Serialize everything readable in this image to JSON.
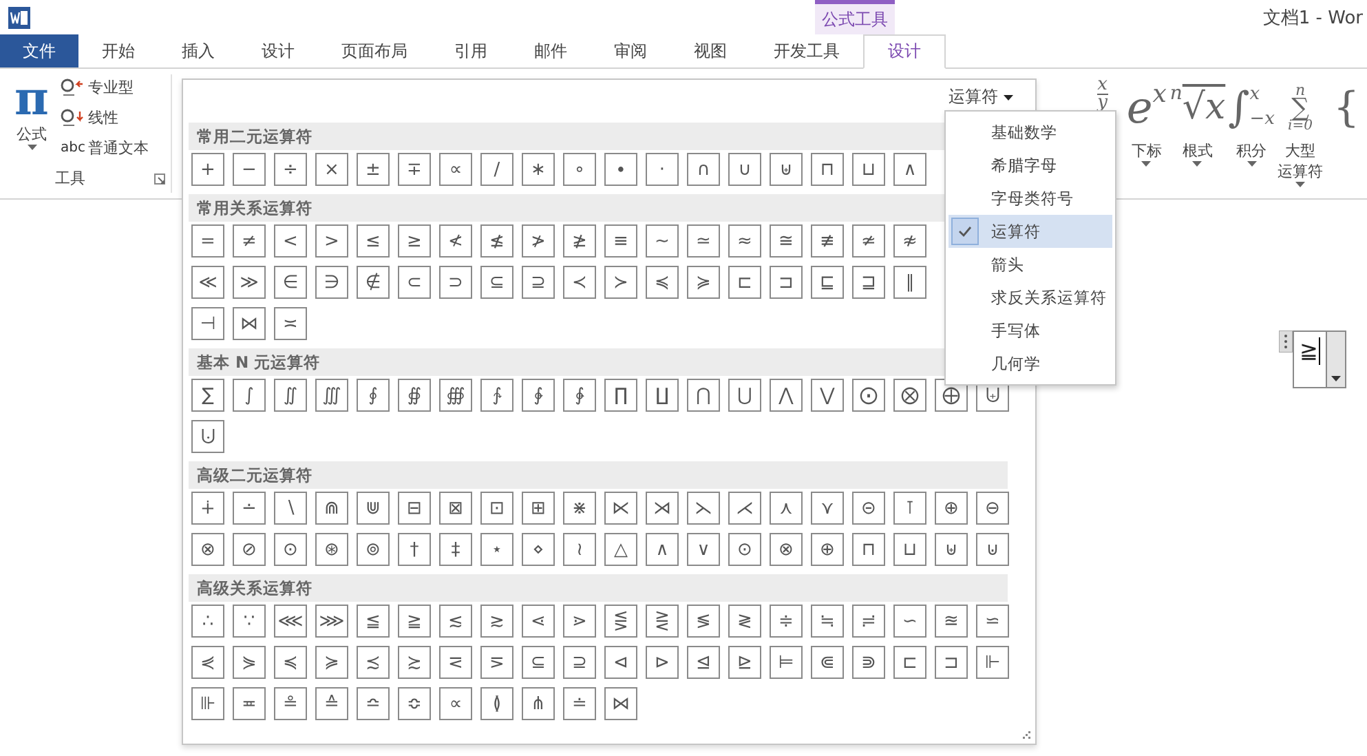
{
  "title_bar": {
    "title": "文档1 - Wor"
  },
  "contextual_group": {
    "label": "公式工具"
  },
  "tabs": [
    {
      "label": "文件",
      "kind": "file",
      "selected": false
    },
    {
      "label": "开始",
      "kind": "normal",
      "selected": false
    },
    {
      "label": "插入",
      "kind": "normal",
      "selected": false
    },
    {
      "label": "设计",
      "kind": "normal",
      "selected": false
    },
    {
      "label": "页面布局",
      "kind": "normal",
      "selected": false
    },
    {
      "label": "引用",
      "kind": "normal",
      "selected": false
    },
    {
      "label": "邮件",
      "kind": "normal",
      "selected": false
    },
    {
      "label": "审阅",
      "kind": "normal",
      "selected": false
    },
    {
      "label": "视图",
      "kind": "normal",
      "selected": false
    },
    {
      "label": "开发工具",
      "kind": "normal",
      "selected": false
    },
    {
      "label": "设计",
      "kind": "contextual",
      "selected": true
    }
  ],
  "tools_group": {
    "label": "工具",
    "equation_button": {
      "icon": "π",
      "label": "公式"
    },
    "options": [
      {
        "label": "专业型",
        "kind": "professional"
      },
      {
        "label": "线性",
        "kind": "linear"
      },
      {
        "label": "普通文本",
        "kind": "text",
        "prefix": "abc"
      }
    ]
  },
  "structures": [
    {
      "kind": "fraction",
      "upper": "x",
      "lower": "y"
    },
    {
      "kind": "script",
      "main": "e",
      "upper": "x",
      "label": "下标"
    },
    {
      "kind": "radical",
      "main": "√x",
      "upper": "n",
      "label": "根式"
    },
    {
      "kind": "integral",
      "main": "∫",
      "upper": "x",
      "lower": "−x",
      "label": "积分"
    },
    {
      "kind": "large-operator",
      "main": "∑",
      "upper": "n",
      "lower": "i=0",
      "label_lines": [
        "大型",
        "运算符"
      ]
    },
    {
      "kind": "bracket",
      "main": "{"
    }
  ],
  "gallery": {
    "category": "运算符",
    "sections": [
      {
        "title": "常用二元运算符",
        "rows": [
          [
            "+",
            "−",
            "÷",
            "×",
            "±",
            "∓",
            "∝",
            "∕",
            "∗",
            "∘",
            "∙",
            "⋅",
            "∩",
            "∪",
            "⊎",
            "⊓",
            "⊔",
            "∧"
          ]
        ]
      },
      {
        "title": "常用关系运算符",
        "rows": [
          [
            "=",
            "≠",
            "<",
            ">",
            "≤",
            "≥",
            "≮",
            "≰",
            "≯",
            "≱",
            "≡",
            "∼",
            "≃",
            "≈",
            "≅",
            "≢",
            "≄",
            "≉"
          ],
          [
            "≪",
            "≫",
            "∈",
            "∋",
            "∉",
            "⊂",
            "⊃",
            "⊆",
            "⊇",
            "≺",
            "≻",
            "≼",
            "≽",
            "⊏",
            "⊐",
            "⊑",
            "⊒",
            "∥"
          ],
          [
            "⊣",
            "⋈",
            "≍"
          ]
        ]
      },
      {
        "title": "基本 N 元运算符",
        "rows": [
          [
            "∑",
            "∫",
            "∬",
            "∭",
            "∮",
            "∯",
            "∰",
            "∱",
            "∲",
            "∳",
            "∏",
            "∐",
            "⋂",
            "⋃",
            "⋀",
            "⋁",
            "⨀",
            "⨂",
            "⨁",
            "⨄"
          ],
          [
            "⨃"
          ]
        ]
      },
      {
        "title": "高级二元运算符",
        "rows": [
          [
            "∔",
            "∸",
            "∖",
            "⋒",
            "⋓",
            "⊟",
            "⊠",
            "⊡",
            "⊞",
            "⋇",
            "⋉",
            "⋊",
            "⋋",
            "⋌",
            "⋏",
            "⋎",
            "⊝",
            "⊺",
            "⊕",
            "⊖"
          ],
          [
            "⊗",
            "⊘",
            "⊙",
            "⊛",
            "⊚",
            "†",
            "‡",
            "⋆",
            "⋄",
            "≀",
            "△",
            "∧",
            "∨",
            "⊙",
            "⊗",
            "⊕",
            "⊓",
            "⊔",
            "⊎",
            "⊍"
          ]
        ]
      },
      {
        "title": "高级关系运算符",
        "rows": [
          [
            "∴",
            "∵",
            "⋘",
            "⋙",
            "≦",
            "≧",
            "≲",
            "≳",
            "⋖",
            "⋗",
            "⋚",
            "⋛",
            "≶",
            "≷",
            "≑",
            "≒",
            "≓",
            "∽",
            "≊",
            "⋍"
          ],
          [
            "⋞",
            "⋟",
            "≼",
            "≽",
            "≾",
            "≿",
            "⋜",
            "⋝",
            "⊆",
            "⊇",
            "⊲",
            "⊳",
            "⊴",
            "⊵",
            "⊨",
            "⋐",
            "⋑",
            "⊏",
            "⊐",
            "⊩"
          ],
          [
            "⊪",
            "≖",
            "≗",
            "≙",
            "≏",
            "≎",
            "∝",
            "≬",
            "⋔",
            "≐",
            "⋈"
          ]
        ]
      }
    ]
  },
  "category_menu": [
    {
      "label": "基础数学",
      "selected": false
    },
    {
      "label": "希腊字母",
      "selected": false
    },
    {
      "label": "字母类符号",
      "selected": false
    },
    {
      "label": "运算符",
      "selected": true
    },
    {
      "label": "箭头",
      "selected": false
    },
    {
      "label": "求反关系运算符",
      "selected": false
    },
    {
      "label": "手写体",
      "selected": false
    },
    {
      "label": "几何学",
      "selected": false
    }
  ],
  "document": {
    "equation": "≧"
  }
}
